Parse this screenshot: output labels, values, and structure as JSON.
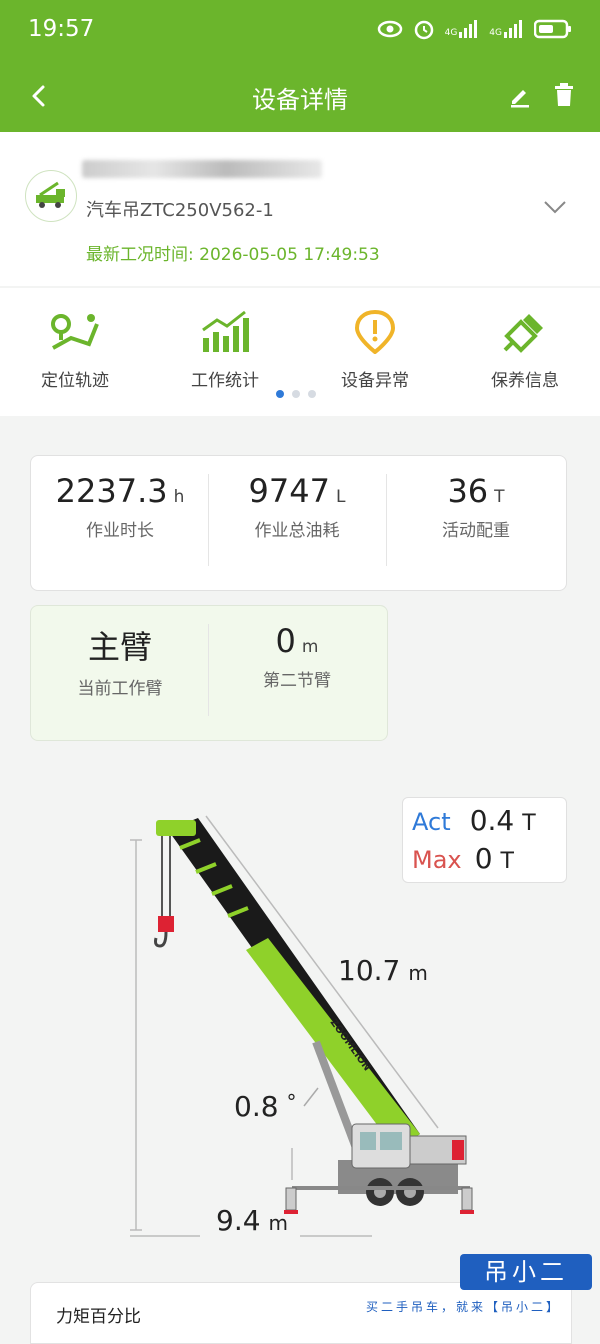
{
  "status_bar": {
    "time": "19:57",
    "network_label_1": "4G",
    "network_label_2": "4G"
  },
  "header": {
    "title": "设备详情"
  },
  "device": {
    "model": "汽车吊ZTC250V562-1",
    "update_time": "最新工况时间: 2026-05-05 17:49:53"
  },
  "features": [
    {
      "label": "定位轨迹",
      "icon": "location-track-icon"
    },
    {
      "label": "工作统计",
      "icon": "work-stats-icon"
    },
    {
      "label": "设备异常",
      "icon": "device-alert-icon"
    },
    {
      "label": "保养信息",
      "icon": "maintenance-icon"
    }
  ],
  "stats": [
    {
      "value": "2237.3",
      "unit": "h",
      "label": "作业时长"
    },
    {
      "value": "9747",
      "unit": "L",
      "label": "作业总油耗"
    },
    {
      "value": "36",
      "unit": "T",
      "label": "活动配重"
    }
  ],
  "boom_info": [
    {
      "value": "主臂",
      "unit": "",
      "label": "当前工作臂"
    },
    {
      "value": "0",
      "unit": "m",
      "label": "第二节臂"
    }
  ],
  "load": {
    "act_label": "Act",
    "act_value": "0.4",
    "act_unit": "T",
    "max_label": "Max",
    "max_value": "0",
    "max_unit": "T"
  },
  "crane": {
    "boom_length": "10.7",
    "boom_length_unit": "m",
    "angle": "0.8",
    "angle_unit": "°",
    "radius": "9.4",
    "radius_unit": "m",
    "brand": "ZOOMLION"
  },
  "bottom": {
    "title": "力矩百分比"
  },
  "watermark": {
    "text": "吊小二",
    "sub": "买二手吊车，就来【吊小二】"
  },
  "colors": {
    "brand_green": "#6bb52c",
    "act_blue": "#2f7ad8",
    "max_red": "#d9534f",
    "dot_active": "#2f7ad8"
  }
}
